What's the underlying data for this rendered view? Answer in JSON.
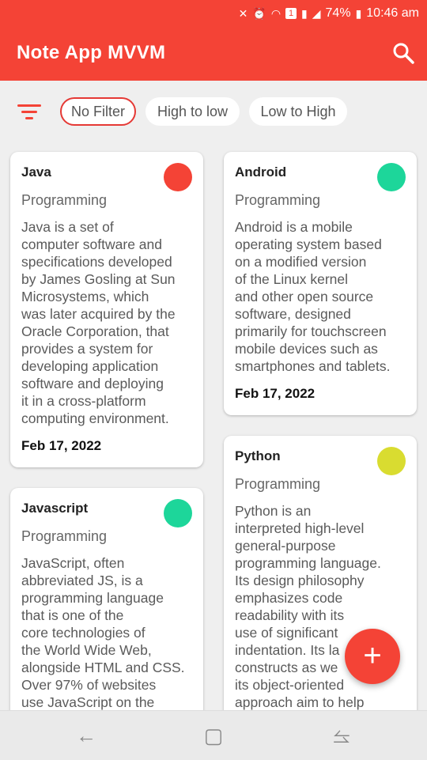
{
  "status_bar": {
    "battery": "74%",
    "time": "10:46 am",
    "notification_count": "1"
  },
  "app": {
    "title": "Note App MVVM"
  },
  "filters": {
    "options": [
      "No Filter",
      "High to low",
      "Low to High"
    ],
    "selected": "No Filter"
  },
  "notes": [
    {
      "title": "Java",
      "category": "Programming",
      "color": "#f44336",
      "description": "Java is a set of\ncomputer software and\nspecifications developed\nby James Gosling at Sun\nMicrosystems, which\nwas later acquired by the\nOracle Corporation, that\nprovides a system for\ndeveloping application\nsoftware and deploying\nit in a cross-platform\ncomputing environment.",
      "date": "Feb 17, 2022"
    },
    {
      "title": "Android",
      "category": "Programming",
      "color": "#1dd69a",
      "description": "Android is a mobile\noperating system based\non a modified version\nof the Linux kernel\nand other open source\nsoftware, designed\nprimarily for touchscreen\nmobile devices such as\nsmartphones and tablets.",
      "date": "Feb 17, 2022"
    },
    {
      "title": "Javascript",
      "category": "Programming",
      "color": "#1dd69a",
      "description": "JavaScript, often\nabbreviated JS, is a\nprogramming language\nthat is one of the\ncore technologies of\nthe World Wide Web,\nalongside HTML and CSS.\nOver 97% of websites\nuse JavaScript on the",
      "date": ""
    },
    {
      "title": "Python",
      "category": "Programming",
      "color": "#d9dc30",
      "description": "Python is an\ninterpreted high-level\ngeneral-purpose\nprogramming language.\nIts design philosophy\nemphasizes code\nreadability with its\nuse of significant\nindentation. Its la\nconstructs as we\nits object-oriented\napproach aim to help",
      "date": ""
    }
  ],
  "fab": {
    "label": "+"
  },
  "nav": {
    "back": "←",
    "home": "▢",
    "recent": "⥦"
  }
}
